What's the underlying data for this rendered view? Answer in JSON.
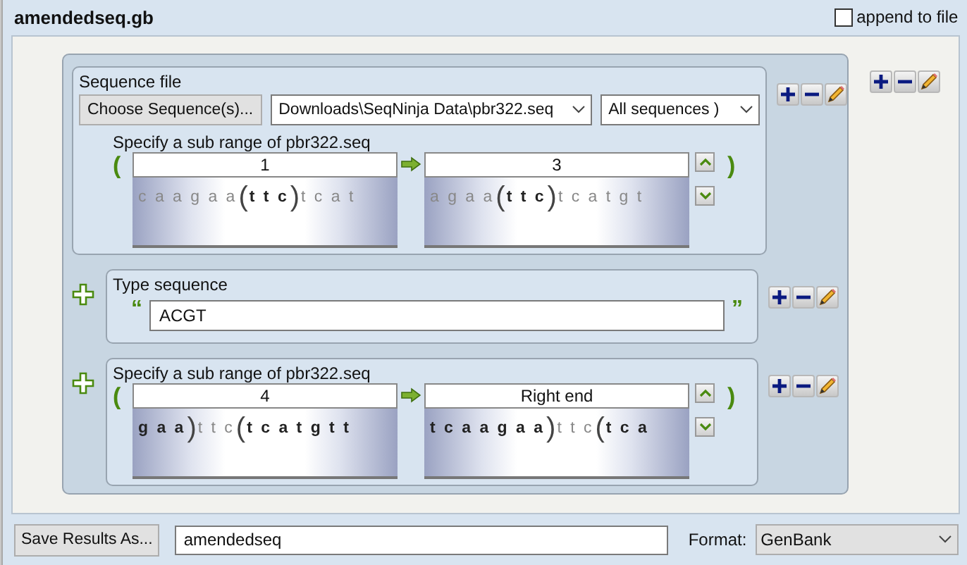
{
  "header": {
    "title": "amendedseq.gb",
    "append_to_file": {
      "label": "append to file",
      "checked": false
    }
  },
  "items": [
    {
      "kind": "file",
      "label": "Sequence file",
      "choose_button": "Choose Sequence(s)...",
      "path": "Downloads\\SeqNinja Data\\pbr322.seq",
      "sequences": "All sequences )",
      "range": {
        "label": "Specify a sub range of pbr322.seq",
        "open": "(",
        "close": ")",
        "start": {
          "value": "1",
          "strip": [
            {
              "kind": "dim",
              "text": "c a a g a a"
            },
            {
              "kind": "paren",
              "text": "("
            },
            {
              "kind": "bold",
              "text": "t t c"
            },
            {
              "kind": "paren",
              "text": ")"
            },
            {
              "kind": "dim",
              "text": "t c a t"
            }
          ]
        },
        "end": {
          "value": "3",
          "strip": [
            {
              "kind": "dim",
              "text": "a g a a"
            },
            {
              "kind": "paren",
              "text": "("
            },
            {
              "kind": "bold",
              "text": "t t c"
            },
            {
              "kind": "paren",
              "text": ")"
            },
            {
              "kind": "dim",
              "text": "t c a t g t"
            }
          ]
        }
      }
    },
    {
      "kind": "typed",
      "label": "Type sequence",
      "open_quote": "“",
      "value": "ACGT",
      "close_quote": "”"
    },
    {
      "kind": "range",
      "range": {
        "label": "Specify a sub range of pbr322.seq",
        "open": "(",
        "close": ")",
        "start": {
          "value": "4",
          "strip": [
            {
              "kind": "bold",
              "text": "g a a"
            },
            {
              "kind": "paren",
              "text": ")"
            },
            {
              "kind": "dim",
              "text": "t t c"
            },
            {
              "kind": "paren",
              "text": "("
            },
            {
              "kind": "bold",
              "text": "t c a t g t t"
            }
          ]
        },
        "end": {
          "value": "Right end",
          "strip": [
            {
              "kind": "bold",
              "text": "t c a a g a a"
            },
            {
              "kind": "paren",
              "text": ")"
            },
            {
              "kind": "dim",
              "text": "t t c"
            },
            {
              "kind": "paren",
              "text": "("
            },
            {
              "kind": "bold",
              "text": "t c a"
            }
          ]
        }
      }
    }
  ],
  "save": {
    "button": "Save Results As...",
    "filename": "amendedseq",
    "format_label": "Format:",
    "format": "GenBank"
  }
}
